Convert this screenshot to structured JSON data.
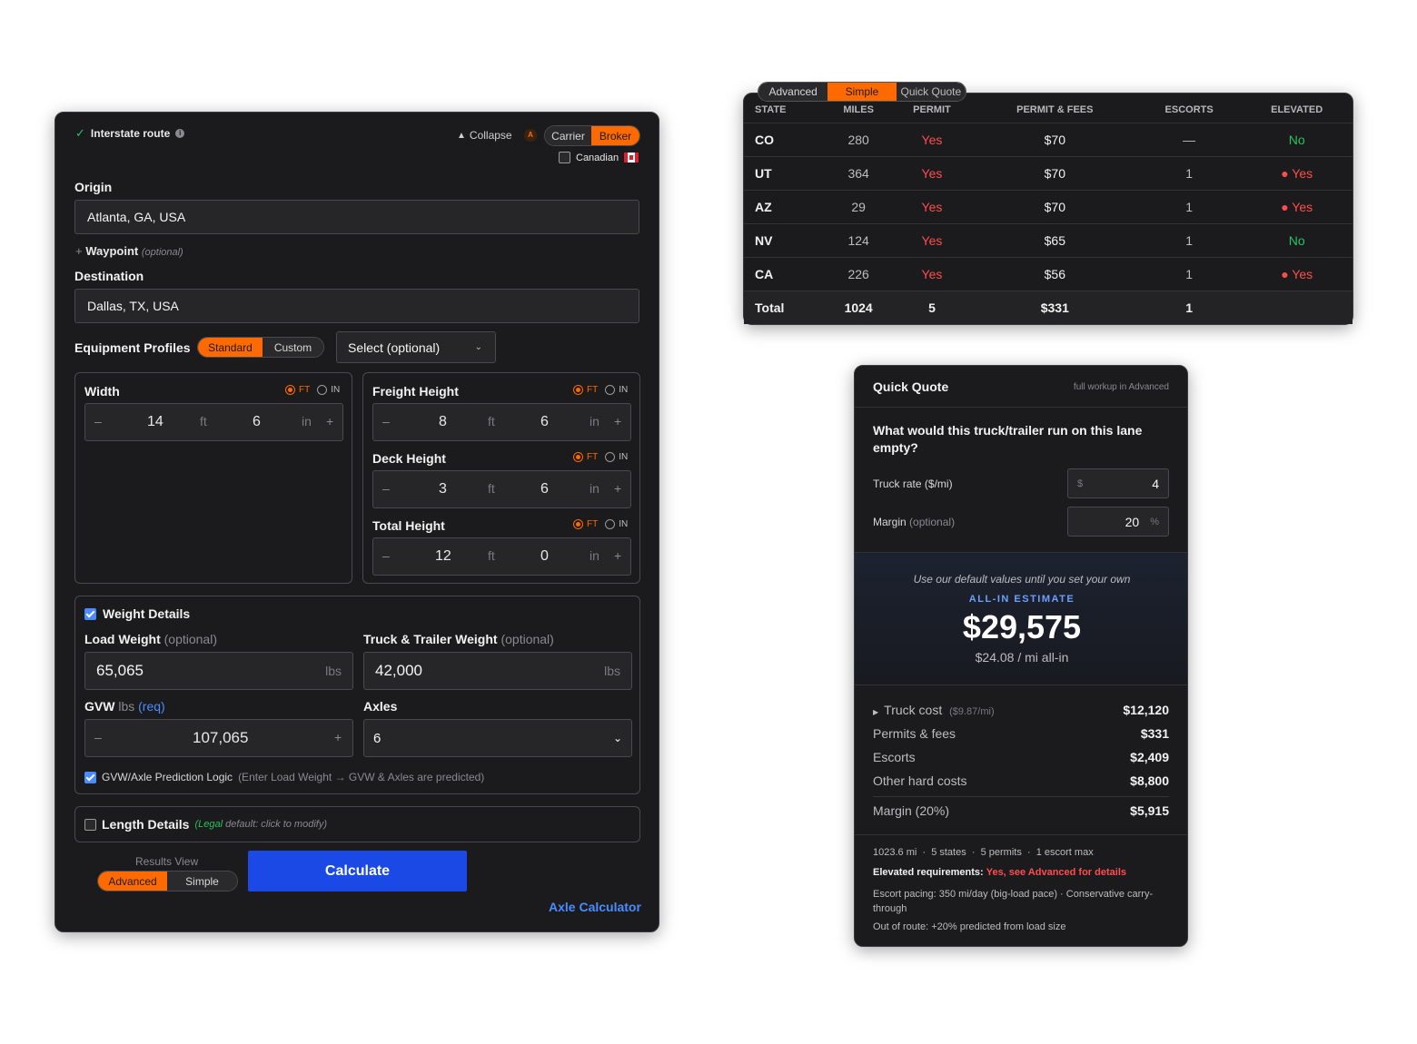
{
  "form": {
    "interstate": "Interstate route",
    "collapse": "Collapse",
    "badge": "A",
    "role_options": [
      "Carrier",
      "Broker"
    ],
    "canadian": "Canadian",
    "origin_label": "Origin",
    "origin_value": "Atlanta, GA, USA",
    "waypoint_label": "Waypoint",
    "waypoint_opt": "(optional)",
    "destination_label": "Destination",
    "destination_value": "Dallas, TX, USA",
    "equipment_label": "Equipment Profiles",
    "profile_options": [
      "Standard",
      "Custom"
    ],
    "select_placeholder": "Select (optional)",
    "unit_ft": "FT",
    "unit_in": "IN",
    "ft": "ft",
    "in": "in",
    "width": {
      "label": "Width",
      "ft": "14",
      "in": "6"
    },
    "freight_height": {
      "label": "Freight Height",
      "ft": "8",
      "in": "6"
    },
    "deck_height": {
      "label": "Deck Height",
      "ft": "3",
      "in": "6"
    },
    "total_height": {
      "label": "Total Height",
      "ft": "12",
      "in": "0"
    },
    "weight_title": "Weight Details",
    "load_weight_label": "Load Weight",
    "truck_weight_label": "Truck & Trailer Weight",
    "optional": "(optional)",
    "load_weight": "65,065",
    "truck_weight": "42,000",
    "lbs": "lbs",
    "gvw_label": "GVW",
    "gvw_unit": "lbs",
    "gvw_req": "(req)",
    "gvw_value": "107,065",
    "axles_label": "Axles",
    "axles_value": "6",
    "prediction_label": "GVW/Axle Prediction Logic",
    "prediction_note": "(Enter Load Weight → GVW & Axles are predicted)",
    "length_title": "Length Details",
    "length_legal": "(Legal",
    "length_note": "default: click to modify)",
    "results_view": "Results View",
    "view_options": [
      "Advanced",
      "Simple"
    ],
    "calculate": "Calculate",
    "axle_calc": "Axle Calculator"
  },
  "table": {
    "modes": [
      "Advanced",
      "Simple",
      "Quick Quote"
    ],
    "headers": [
      "STATE",
      "MILES",
      "PERMIT",
      "PERMIT & FEES",
      "ESCORTS",
      "ELEVATED"
    ],
    "rows": [
      {
        "state": "CO",
        "miles": "280",
        "permit": "Yes",
        "fees": "$70",
        "escorts": "—",
        "elevated": "No"
      },
      {
        "state": "UT",
        "miles": "364",
        "permit": "Yes",
        "fees": "$70",
        "escorts": "1",
        "elevated": "● Yes"
      },
      {
        "state": "AZ",
        "miles": "29",
        "permit": "Yes",
        "fees": "$70",
        "escorts": "1",
        "elevated": "● Yes"
      },
      {
        "state": "NV",
        "miles": "124",
        "permit": "Yes",
        "fees": "$65",
        "escorts": "1",
        "elevated": "No"
      },
      {
        "state": "CA",
        "miles": "226",
        "permit": "Yes",
        "fees": "$56",
        "escorts": "1",
        "elevated": "● Yes"
      }
    ],
    "total": {
      "state": "Total",
      "miles": "1024",
      "permit": "5",
      "fees": "$331",
      "escorts": "1",
      "elevated": ""
    }
  },
  "quote": {
    "title": "Quick Quote",
    "subtitle": "full workup in Advanced",
    "question": "What would this truck/trailer run on this lane empty?",
    "truck_rate_label": "Truck rate ($/mi)",
    "truck_rate_prefix": "$",
    "truck_rate": "4",
    "margin_label": "Margin",
    "margin_opt": "(optional)",
    "margin": "20",
    "margin_suffix": "%",
    "defaults_note": "Use our default values until you set your own",
    "estimate_label": "ALL-IN ESTIMATE",
    "estimate": "$29,575",
    "per_mile": "$24.08 / mi all-in",
    "truck_cost_label": "Truck cost",
    "truck_cost_rate": "($9.87/mi)",
    "truck_cost": "$12,120",
    "permits_label": "Permits & fees",
    "permits": "$331",
    "escorts_label": "Escorts",
    "escorts": "$2,409",
    "other_label": "Other hard costs",
    "other": "$8,800",
    "margin_row_label": "Margin (20%)",
    "margin_row": "$5,915",
    "summary": "1023.6 mi  ·  5 states  ·  5 permits  ·  1 escort max",
    "elevated_label": "Elevated requirements:",
    "elevated_value": "Yes, see Advanced for details",
    "pacing": "Escort pacing: 350 mi/day (big-load pace) · Conservative carry-through",
    "out_of_route": "Out of route: +20% predicted from load size"
  }
}
